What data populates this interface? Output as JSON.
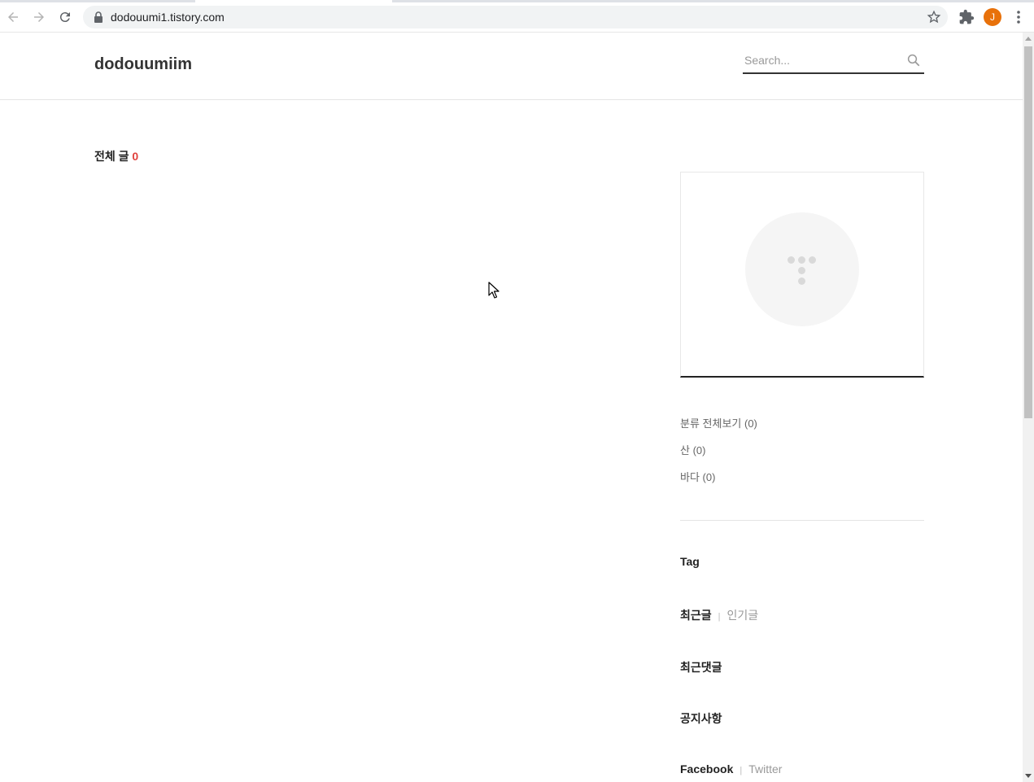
{
  "browser": {
    "url": "dodouumi1.tistory.com",
    "profile_initial": "J"
  },
  "blog": {
    "title": "dodouumiim",
    "search_placeholder": "Search..."
  },
  "main": {
    "total_label": "전체 글",
    "total_count": "0"
  },
  "sidebar": {
    "categories": [
      {
        "label": "분류 전체보기 (0)"
      },
      {
        "label": "산 (0)"
      },
      {
        "label": "바다 (0)"
      }
    ],
    "tag_heading": "Tag",
    "recent_tab": "최근글",
    "popular_tab": "인기글",
    "recent_comments": "최근댓글",
    "notice": "공지사항",
    "facebook": "Facebook",
    "twitter": "Twitter",
    "separator": "|"
  },
  "colors": {
    "accent": "#e0413d",
    "avatar": "#e8710a"
  }
}
